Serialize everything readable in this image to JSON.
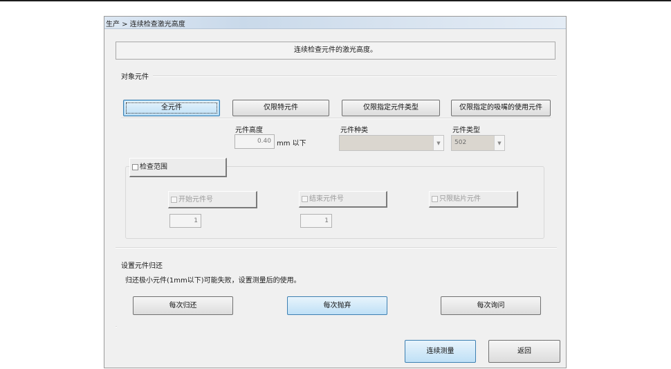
{
  "window": {
    "title": "生产 > 连续检查激光高度"
  },
  "message": "连续检查元件的激光高度。",
  "target_section": {
    "title": "对象元件",
    "buttons": {
      "all": "全元件",
      "only_specified": "仅限特元件",
      "only_type": "仅限指定元件类型",
      "only_nozzle": "仅限指定的吸嘴的使用元件"
    },
    "height_label": "元件高度",
    "height_value": "0.40",
    "height_unit": "mm 以下",
    "kind_label": "元件种类",
    "kind_value": "",
    "type_label": "元件类型",
    "type_value": "502"
  },
  "range": {
    "checkbox_label": "检查范围",
    "start_label": "开始元件号",
    "start_value": "1",
    "end_label": "结束元件号",
    "end_value": "1",
    "chip_only_label": "只限贴片元件"
  },
  "return_section": {
    "title": "设置元件归还",
    "note": "归还极小元件(1mm以下)可能失败，设置测量后的使用。",
    "buttons": {
      "each_return": "每次归还",
      "each_discard": "每次抛弃",
      "each_ask": "每次询问"
    }
  },
  "footer": {
    "measure": "连续测量",
    "back": "返回"
  }
}
